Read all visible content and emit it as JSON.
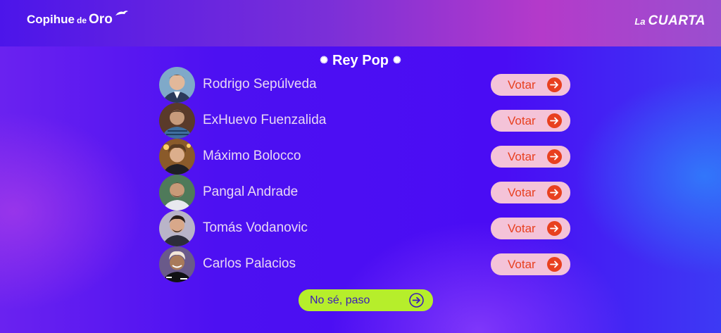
{
  "header": {
    "logo_left": {
      "main": "Copihue",
      "de": "de",
      "oro": "Oro"
    },
    "logo_right": {
      "la": "La",
      "cuarta": "CUARTA"
    }
  },
  "category": {
    "title": "Rey Pop",
    "spark": "✺"
  },
  "candidates": [
    {
      "name": "Rodrigo Sepúlveda",
      "vote_label": "Votar"
    },
    {
      "name": "ExHuevo Fuenzalida",
      "vote_label": "Votar"
    },
    {
      "name": "Máximo Bolocco",
      "vote_label": "Votar"
    },
    {
      "name": "Pangal Andrade",
      "vote_label": "Votar"
    },
    {
      "name": "Tomás Vodanovic",
      "vote_label": "Votar"
    },
    {
      "name": "Carlos Palacios",
      "vote_label": "Votar"
    }
  ],
  "skip": {
    "label": "No sé, paso"
  },
  "colors": {
    "vote_bg": "#f4c3d8",
    "vote_accent": "#e8401f",
    "skip_bg": "#b6ee2b",
    "skip_text": "#3b1bb8"
  }
}
